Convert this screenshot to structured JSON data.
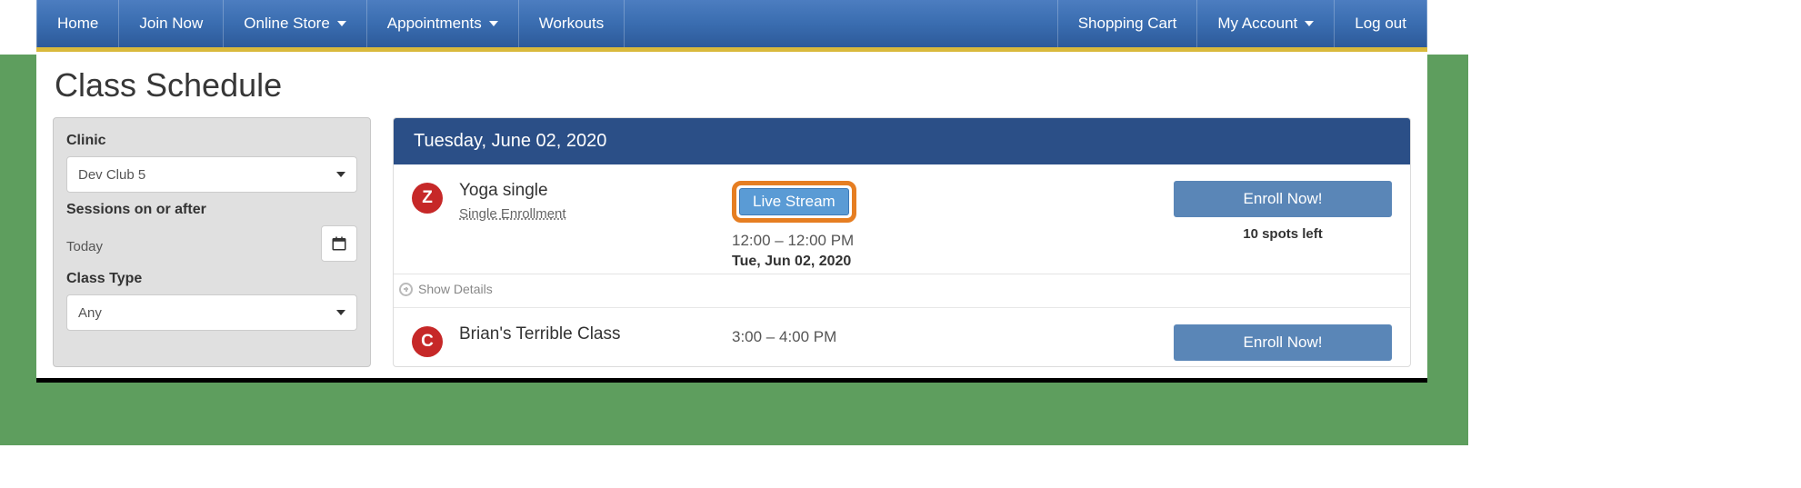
{
  "nav": {
    "left": [
      {
        "label": "Home",
        "name": "nav-home",
        "dropdown": false
      },
      {
        "label": "Join Now",
        "name": "nav-join-now",
        "dropdown": false
      },
      {
        "label": "Online Store",
        "name": "nav-online-store",
        "dropdown": true
      },
      {
        "label": "Appointments",
        "name": "nav-appointments",
        "dropdown": true
      },
      {
        "label": "Workouts",
        "name": "nav-workouts",
        "dropdown": false
      }
    ],
    "right": [
      {
        "label": "Shopping Cart",
        "name": "nav-shopping-cart",
        "dropdown": false
      },
      {
        "label": "My Account",
        "name": "nav-my-account",
        "dropdown": true
      },
      {
        "label": "Log out",
        "name": "nav-log-out",
        "dropdown": false
      }
    ]
  },
  "page": {
    "title": "Class Schedule"
  },
  "filters": {
    "clinic_label": "Clinic",
    "clinic_value": "Dev Club 5",
    "sessions_label": "Sessions on or after",
    "sessions_value": "Today",
    "class_type_label": "Class Type",
    "class_type_value": "Any"
  },
  "schedule": {
    "header": "Tuesday, June 02, 2020",
    "show_details_label": "Show Details",
    "classes": [
      {
        "badge": "Z",
        "name": "Yoga single",
        "enrollment_type": "Single Enrollment",
        "live_stream_label": "Live Stream",
        "has_live_stream": true,
        "time": "12:00 – 12:00 PM",
        "date": "Tue, Jun 02, 2020",
        "enroll_label": "Enroll Now!",
        "spots": "10 spots left"
      },
      {
        "badge": "C",
        "name": "Brian's Terrible Class",
        "enrollment_type": "",
        "live_stream_label": "",
        "has_live_stream": false,
        "time": "3:00 – 4:00 PM",
        "date": "",
        "enroll_label": "Enroll Now!",
        "spots": ""
      }
    ]
  },
  "colors": {
    "nav_gradient_top": "#4c7dc0",
    "nav_gradient_bottom": "#2d5a9a",
    "accent_yellow": "#d9b93c",
    "badge_red": "#c62828",
    "button_blue": "#5a86b7",
    "header_blue": "#2b4f87",
    "highlight_orange": "#e67e22",
    "backdrop_green": "#5e9e5e"
  }
}
